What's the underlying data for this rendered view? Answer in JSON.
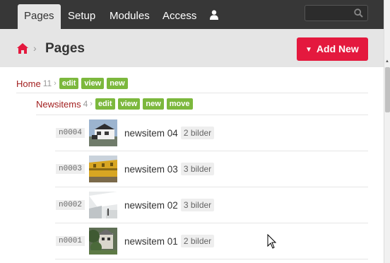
{
  "nav": {
    "tabs": [
      "Pages",
      "Setup",
      "Modules",
      "Access"
    ],
    "user_icon": "user-icon",
    "search_icon": "search-icon"
  },
  "header": {
    "title": "Pages",
    "home_icon": "home-icon",
    "add_button": "Add New"
  },
  "tree": {
    "home": {
      "label": "Home",
      "count": "11",
      "actions": [
        "edit",
        "view",
        "new"
      ]
    },
    "newsitems": {
      "label": "Newsitems",
      "count": "4",
      "actions": [
        "edit",
        "view",
        "new",
        "move"
      ]
    },
    "items": [
      {
        "id": "n0004",
        "title": "newsitem 04",
        "badge": "2 bilder"
      },
      {
        "id": "n0003",
        "title": "newsitem 03",
        "badge": "3 bilder"
      },
      {
        "id": "n0002",
        "title": "newsitem 02",
        "badge": "3 bilder"
      },
      {
        "id": "n0001",
        "title": "newsitem 01",
        "badge": "2 bilder"
      }
    ]
  },
  "colors": {
    "accent": "#e4193e",
    "action_green": "#7cb83d",
    "link_red": "#a21f1f",
    "topbar": "#373737"
  }
}
